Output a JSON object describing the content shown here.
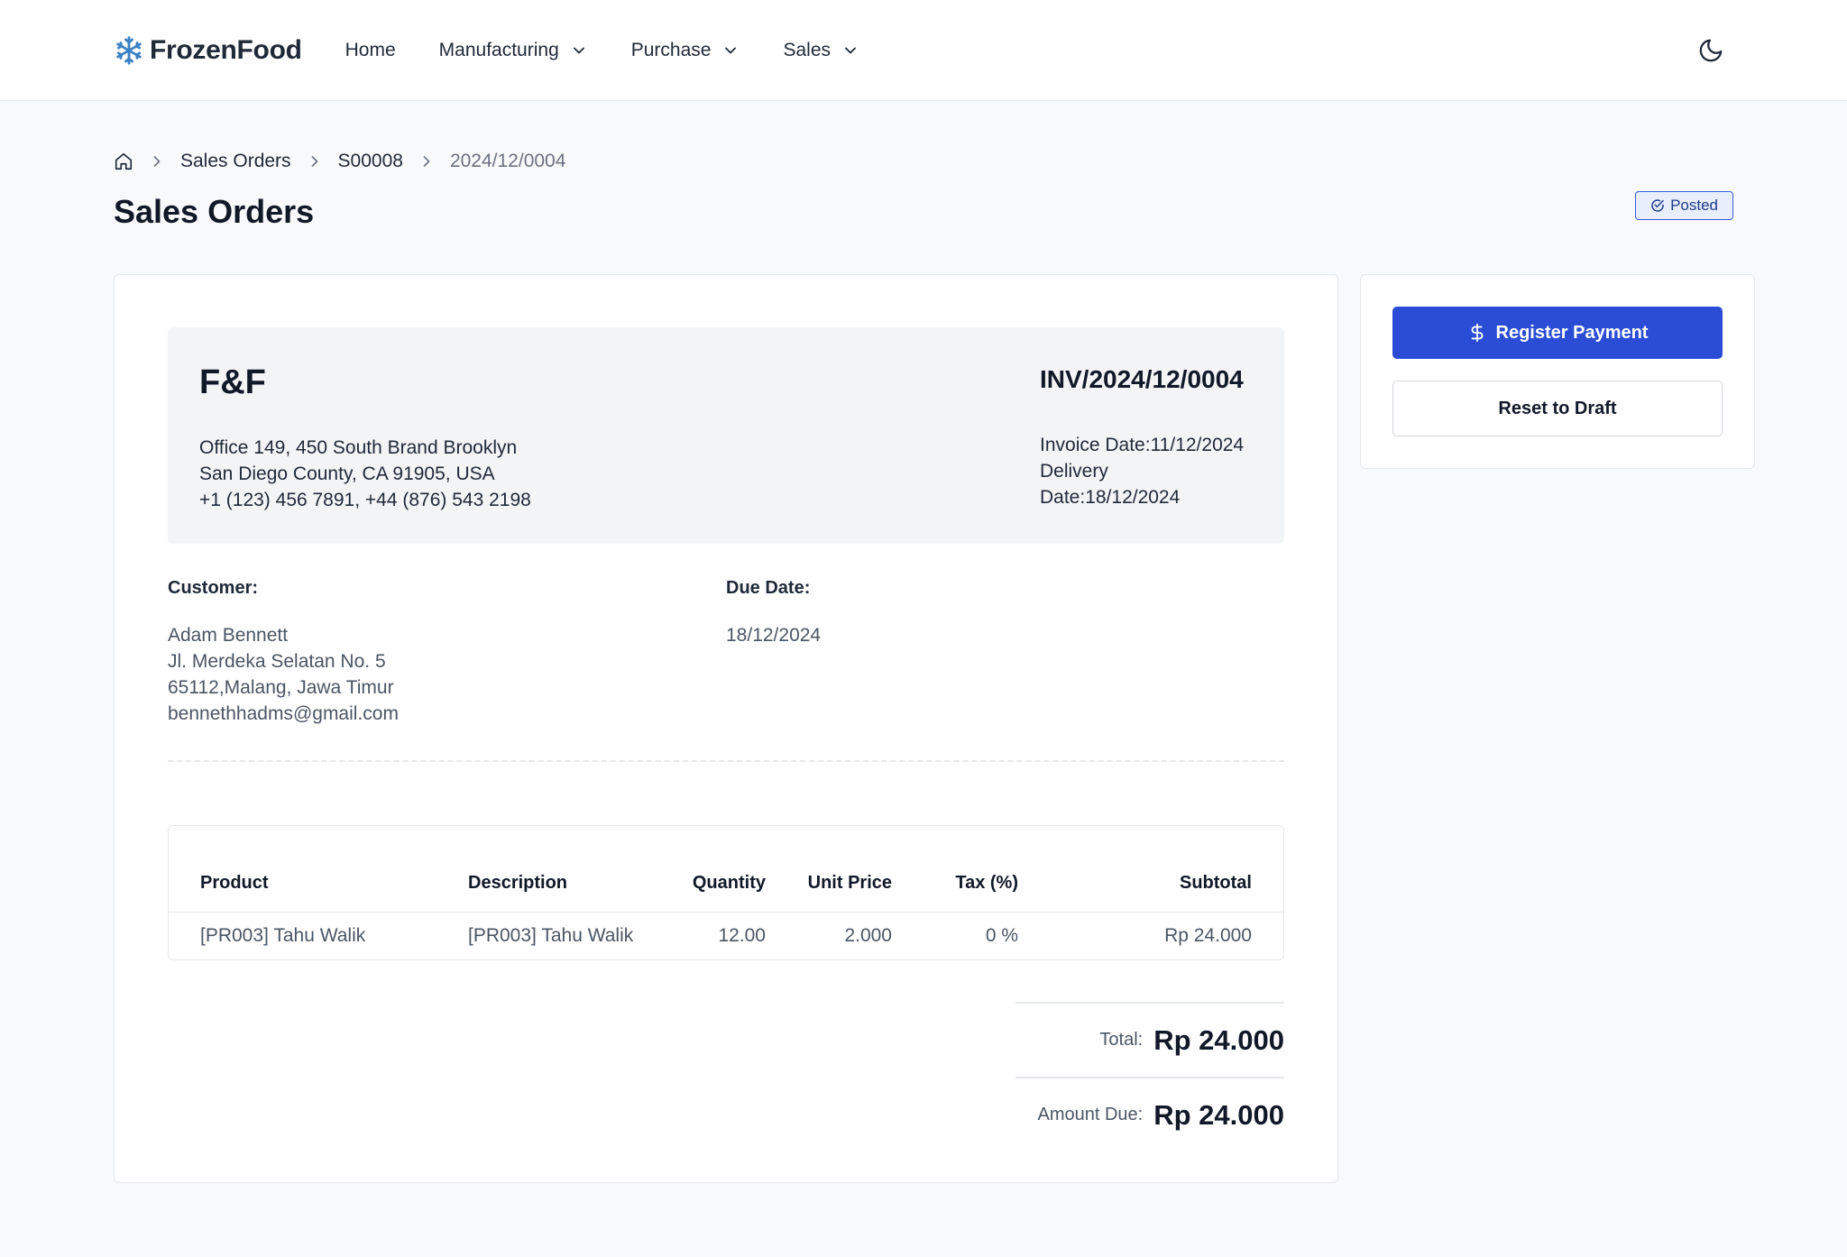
{
  "brand": {
    "name": "FrozenFood",
    "accent": "#2b4dd6",
    "logo_icon": "snowflake-icon"
  },
  "nav": {
    "items": [
      {
        "label": "Home",
        "has_dropdown": false
      },
      {
        "label": "Manufacturing",
        "has_dropdown": true
      },
      {
        "label": "Purchase",
        "has_dropdown": true
      },
      {
        "label": "Sales",
        "has_dropdown": true
      }
    ],
    "theme_icon": "moon-icon"
  },
  "breadcrumb": {
    "home_icon": "home-icon",
    "items": [
      "Sales Orders",
      "S00008",
      "2024/12/0004"
    ]
  },
  "page": {
    "title": "Sales Orders",
    "status": "Posted"
  },
  "company": {
    "name": "F&F",
    "address_lines": [
      "Office 149, 450 South Brand Brooklyn",
      "San Diego County, CA 91905, USA",
      "+1 (123) 456 7891, +44 (876) 543 2198"
    ]
  },
  "invoice": {
    "number": "INV/2024/12/0004",
    "invoice_date": "Invoice Date:11/12/2024",
    "delivery_date": "Delivery Date:18/12/2024"
  },
  "customer": {
    "label": "Customer:",
    "lines": [
      "Adam Bennett",
      "Jl. Merdeka Selatan No. 5",
      "65112,Malang, Jawa Timur",
      "bennethhadms@gmail.com"
    ]
  },
  "due": {
    "label": "Due Date:",
    "value": "18/12/2024"
  },
  "table": {
    "headers": [
      "Product",
      "Description",
      "Quantity",
      "Unit Price",
      "Tax (%)",
      "Subtotal"
    ],
    "rows": [
      [
        "[PR003] Tahu Walik",
        "[PR003] Tahu Walik",
        "12.00",
        "2.000",
        "0 %",
        "Rp 24.000"
      ]
    ]
  },
  "totals": {
    "total_label": "Total:",
    "total_value": "Rp 24.000",
    "amount_due_label": "Amount Due:",
    "amount_due_value": "Rp 24.000"
  },
  "actions": {
    "register_payment": "Register Payment",
    "reset_to_draft": "Reset to Draft"
  }
}
